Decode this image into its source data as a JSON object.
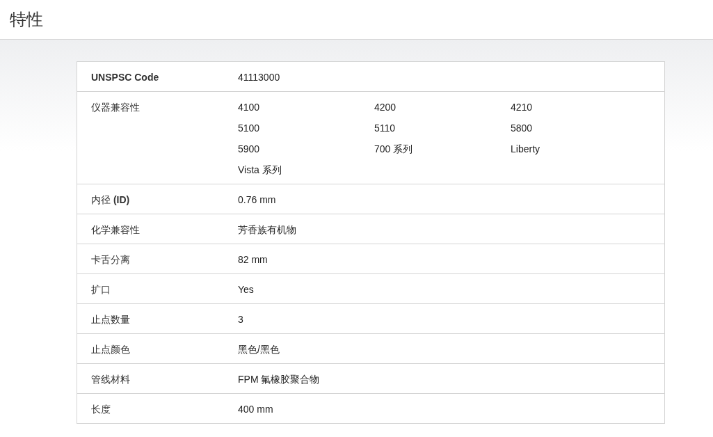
{
  "header": {
    "title": "特性"
  },
  "rows": [
    {
      "kind": "code",
      "label": "UNSPSC Code",
      "values": [
        "41113000"
      ]
    },
    {
      "kind": "grid",
      "label": "仪器兼容性",
      "values": [
        "4100",
        "4200",
        "4210",
        "5100",
        "5110",
        "5800",
        "5900",
        "700 系列",
        "Liberty",
        "Vista 系列"
      ]
    },
    {
      "kind": "plain",
      "label": "内径 **(ID)**",
      "values": [
        "0.76 mm"
      ]
    },
    {
      "kind": "plain",
      "label": "化学兼容性",
      "values": [
        "芳香族有机物"
      ]
    },
    {
      "kind": "plain",
      "label": "卡舌分离",
      "values": [
        "82 mm"
      ]
    },
    {
      "kind": "plain",
      "label": "扩口",
      "values": [
        "Yes"
      ]
    },
    {
      "kind": "plain",
      "label": "止点数量",
      "values": [
        "3"
      ]
    },
    {
      "kind": "plain",
      "label": "止点颜色",
      "values": [
        "黑色/黑色"
      ]
    },
    {
      "kind": "plain",
      "label": "管线材料",
      "values": [
        "FPM 氟橡胶聚合物"
      ]
    },
    {
      "kind": "plain",
      "label": "长度",
      "values": [
        "400 mm"
      ]
    }
  ]
}
